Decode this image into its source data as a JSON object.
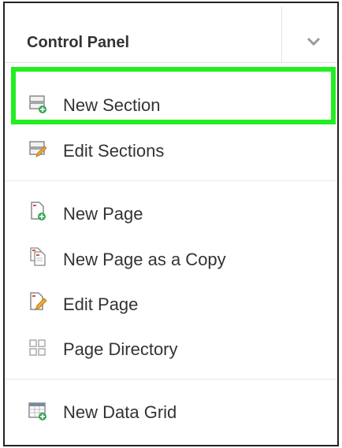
{
  "panel": {
    "title": "Control Panel",
    "toggle_icon": "chevron-down-icon"
  },
  "menu": {
    "items": [
      {
        "label": "New Section",
        "icon": "new-section-icon",
        "highlighted": true
      },
      {
        "label": "Edit Sections",
        "icon": "edit-sections-icon"
      },
      {
        "label": "New Page",
        "icon": "new-page-icon"
      },
      {
        "label": "New Page as a Copy",
        "icon": "copy-page-icon"
      },
      {
        "label": "Edit Page",
        "icon": "edit-page-icon"
      },
      {
        "label": "Page Directory",
        "icon": "page-directory-icon"
      },
      {
        "label": "New Data Grid",
        "icon": "new-data-grid-icon"
      }
    ]
  },
  "colors": {
    "highlight": "#22ee22",
    "text": "#333333",
    "add_badge": "#3aa655",
    "edit_pencil": "#f0a830",
    "page_red": "#d9534f"
  }
}
